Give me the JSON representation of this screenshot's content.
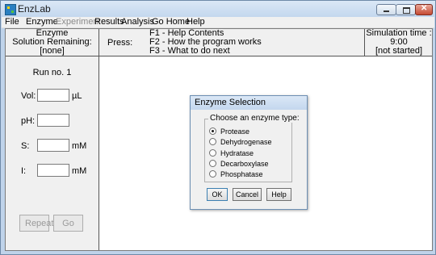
{
  "window": {
    "title": "EnzLab"
  },
  "menu": {
    "items": [
      {
        "label": "File",
        "enabled": true
      },
      {
        "label": "Enzyme",
        "enabled": true
      },
      {
        "label": "Experiment",
        "enabled": false
      },
      {
        "label": "Results",
        "enabled": true
      },
      {
        "label": "Analysis",
        "enabled": true
      },
      {
        "label": "Go Home",
        "enabled": true
      },
      {
        "label": "Help",
        "enabled": true
      }
    ]
  },
  "info": {
    "enzyme_line1": "Enzyme",
    "enzyme_line2": "Solution Remaining:",
    "enzyme_value": "[none]",
    "press_label": "Press:",
    "help_keys": [
      "F1 - Help Contents",
      "F2 - How the program works",
      "F3 - What to do next"
    ],
    "sim_label": "Simulation time :",
    "sim_time": "9:00",
    "sim_status": "[not started]"
  },
  "run": {
    "title": "Run no. 1",
    "fields": [
      {
        "label": "Vol:",
        "value": "",
        "unit": "µL"
      },
      {
        "label": "pH:",
        "value": "",
        "unit": ""
      },
      {
        "label": "S:",
        "value": "",
        "unit": "mM"
      },
      {
        "label": "I:",
        "value": "",
        "unit": "mM"
      }
    ],
    "repeat_label": "Repeat",
    "go_label": "Go"
  },
  "dialog": {
    "title": "Enzyme Selection",
    "group_label": "Choose an enzyme type:",
    "options": [
      "Protease",
      "Dehydrogenase",
      "Hydratase",
      "Decarboxylase",
      "Phosphatase"
    ],
    "selected": "Protease",
    "ok_label": "OK",
    "cancel_label": "Cancel",
    "help_label": "Help"
  },
  "icons": {
    "app": "enzlab-app-icon",
    "minimize": "minimize-icon",
    "maximize": "maximize-icon",
    "close": "close-icon"
  }
}
